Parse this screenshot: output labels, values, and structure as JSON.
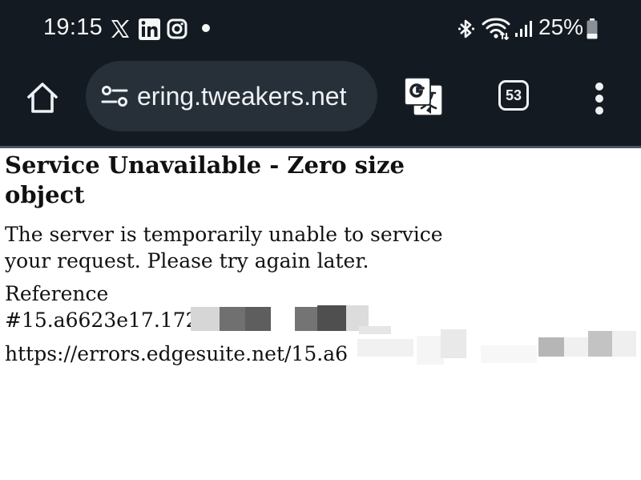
{
  "status_bar": {
    "time": "19:15",
    "notification_icons": [
      "x-icon",
      "linkedin-icon",
      "instagram-icon"
    ],
    "battery": "25%"
  },
  "toolbar": {
    "url": "ering.tweakers.net",
    "tab_count": "53"
  },
  "page": {
    "title": "Service Unavailable - Zero size object",
    "message": "The server is temporarily unable to service your request. Please try again later.",
    "reference_label": "Reference",
    "reference_id": "#15.a6623e17.172",
    "error_url": "https://errors.edgesuite.net/15.a6"
  },
  "colors": {
    "chrome_background": "#141a21",
    "urlbar_background": "#273039",
    "chrome_foreground": "#eef1f4",
    "page_background": "#ffffff",
    "page_text": "#111111"
  }
}
